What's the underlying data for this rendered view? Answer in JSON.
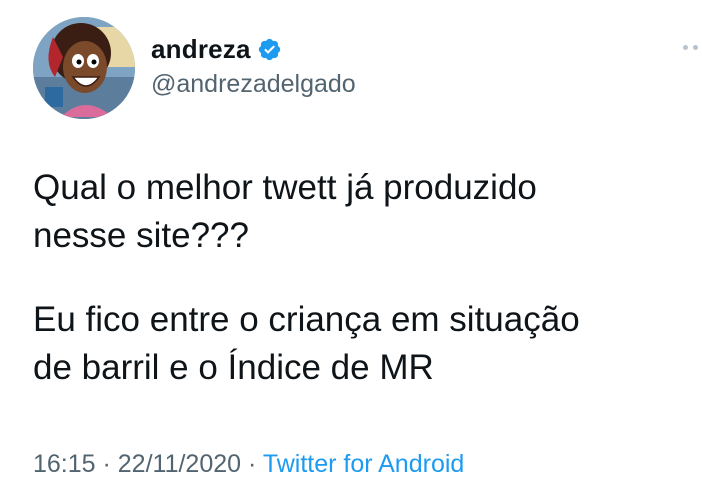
{
  "user": {
    "display_name": "andreza",
    "handle": "@andrezadelgado",
    "verified_icon": "verified-badge-icon",
    "avatar_icon": "cartoon-avatar"
  },
  "tweet": {
    "paragraph1": [
      "Qual o melhor twett já produzido",
      "nesse site???"
    ],
    "paragraph2": [
      "Eu fico entre o criança em situação",
      "de barril e o Índice de MR"
    ]
  },
  "meta": {
    "time": "16:15",
    "separator": " · ",
    "date": "22/11/2020",
    "source": "Twitter for Android"
  },
  "colors": {
    "text": "#0f1419",
    "secondary": "#536471",
    "accent": "#1d9bf0"
  }
}
